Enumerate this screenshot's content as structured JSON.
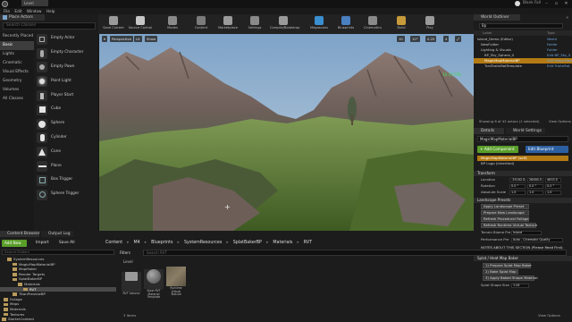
{
  "titlebar": {
    "doc_tab": "Level",
    "project": "Blank Fall",
    "min": "–",
    "max": "▫",
    "close": "✕",
    "logo": "U"
  },
  "menu": [
    "File",
    "Edit",
    "Window",
    "Help"
  ],
  "place_actors": {
    "tab": "Place Actors",
    "search_placeholder": "Search Classes",
    "categories": [
      "Recently Placed",
      "Basic",
      "Lights",
      "Cinematic",
      "Visual Effects",
      "Geometry",
      "Volumes",
      "All Classes"
    ],
    "selected_category": "Basic",
    "actors": [
      {
        "label": "Empty Actor",
        "icon": "empty-actor-icon"
      },
      {
        "label": "Empty Character",
        "icon": "character-icon"
      },
      {
        "label": "Empty Pawn",
        "icon": "pawn-icon"
      },
      {
        "label": "Point Light",
        "icon": "point-light-icon"
      },
      {
        "label": "Player Start",
        "icon": "player-start-icon"
      },
      {
        "label": "Cube",
        "icon": "cube-icon"
      },
      {
        "label": "Sphere",
        "icon": "sphere-icon"
      },
      {
        "label": "Cylinder",
        "icon": "cylinder-icon"
      },
      {
        "label": "Cone",
        "icon": "cone-icon"
      },
      {
        "label": "Plane",
        "icon": "plane-icon"
      },
      {
        "label": "Box Trigger",
        "icon": "box-trigger-icon"
      },
      {
        "label": "Sphere Trigger",
        "icon": "sphere-trigger-icon"
      }
    ]
  },
  "toolbar": {
    "buttons": [
      {
        "label": "Save Current",
        "icon": "save-icon",
        "color": "#9a9a9a"
      },
      {
        "label": "Source Control",
        "icon": "source-control-icon",
        "color": "#c6c6c6"
      },
      {
        "label": "Modes",
        "icon": "modes-icon",
        "color": "#8a8a8a"
      },
      {
        "label": "Content",
        "icon": "content-icon",
        "color": "#7b7b7b"
      },
      {
        "label": "Marketplace",
        "icon": "marketplace-icon",
        "color": "#9a9a9a"
      },
      {
        "label": "Settings",
        "icon": "settings-icon",
        "color": "#8a8a8a"
      },
      {
        "label": "Compile/Bootstrap",
        "icon": "compile-icon",
        "color": "#9a9a9a"
      },
      {
        "label": "Megascans",
        "icon": "megascans-icon",
        "color": "#3a8fd0"
      },
      {
        "label": "Blueprints",
        "icon": "blueprints-icon",
        "color": "#4a7fc0"
      },
      {
        "label": "Cinematics",
        "icon": "cinematics-icon",
        "color": "#8a8a8a"
      },
      {
        "label": "Build",
        "icon": "build-icon",
        "color": "#c79a3a"
      },
      {
        "label": "Play",
        "icon": "play-icon",
        "color": "#9a9a9a"
      }
    ]
  },
  "viewport": {
    "perspective": "Perspective",
    "lit": "Lit",
    "show": "Show",
    "fps": "16.15 FPS",
    "cursor": "+",
    "snap_values": [
      "10",
      "10°",
      "0.25",
      "4"
    ]
  },
  "world_outliner": {
    "tab": "World Outliner",
    "search_value": "Bp",
    "col_label": "Label",
    "col_type": "Type",
    "rows": [
      {
        "label": "Island_Demo (Editor)",
        "type": "World",
        "hl": false
      },
      {
        "label": "NewFolder",
        "type": "Folder",
        "hl": false
      },
      {
        "label": "Lighting & Visuals",
        "type": "Folder",
        "hl": false
      },
      {
        "label": "BP_Sky_Sphere_0",
        "type": "Edit BP_Sky_S",
        "hl": false
      },
      {
        "label": "MagicMapMaterialBP",
        "type": "Edit MagicMap",
        "hl": true
      },
      {
        "label": "TrailTrailsMatTemplate",
        "type": "Edit TrailsMat",
        "hl": false
      }
    ],
    "status": "Showing 6 of 42 actors (1 selected)",
    "view_options": "View Options"
  },
  "details": {
    "tab": "Details",
    "tab2": "World Settings",
    "search_value": "MagicMapMaterialBP",
    "add_component": "+ Add Component",
    "edit_blueprint": "Edit Blueprint",
    "component_selected": "MagicMapMaterialBP (self)",
    "component_sub": "BP Logo (Inherited)",
    "transform_header": "Transform",
    "location_label": "Location",
    "rotation_label": "Rotation",
    "scale_label": "Absolute Scale",
    "location": [
      "-33162.0",
      "28480.0",
      "4633.0"
    ],
    "rotation": [
      "0.0 °",
      "0.0 °",
      "0.0 °"
    ],
    "scale": [
      "1.0",
      "1.0",
      "1.0"
    ],
    "landscape_presets": "Landscape Presets",
    "preset_buttons": [
      "Apply Landscape Preset",
      "Prepare New Landscape",
      "Refresh Procedural Foliage",
      "Refresh Runtime Virtual Texture"
    ],
    "terrain_biome_label": "Terrain Biome Pre",
    "terrain_biome_value": "Island",
    "performance_label": "Performance Pre",
    "performance_value": "Auto - Cinematic Quality",
    "notes": "NOTES ABOUT THIS SECTION (Please Read First)",
    "splat_header": "Splat / Heat Map Baker",
    "splat_buttons": [
      "1) Prepare Splat Map Baker",
      "2) Bake Splat Map",
      "3) Apply Baked Shape Material"
    ],
    "splat_size_label": "Splat Shape Size",
    "splat_size_value": "1.04"
  },
  "content_browser": {
    "tab": "Content Browser",
    "tab2": "Output Log",
    "add_new": "Add New",
    "import": "Import",
    "save_all": "Save All",
    "path": [
      "Content",
      "M4",
      "Blueprints",
      "SystemResources",
      "SplatBakerBP",
      "Materials",
      "RVT"
    ],
    "tree_search": "Search Folders",
    "tree": [
      {
        "label": "SystemResources",
        "indent": 8,
        "sel": false
      },
      {
        "label": "MagicMapMaterialBP",
        "indent": 14,
        "sel": false
      },
      {
        "label": "MapMaker",
        "indent": 14,
        "sel": false
      },
      {
        "label": "Render Targets",
        "indent": 14,
        "sel": false
      },
      {
        "label": "SplatBakerBP",
        "indent": 14,
        "sel": false
      },
      {
        "label": "Materials",
        "indent": 20,
        "sel": false
      },
      {
        "label": "RVT",
        "indent": 26,
        "sel": true
      },
      {
        "label": "TitanPreviewBP",
        "indent": 14,
        "sel": false
      },
      {
        "label": "Foliage",
        "indent": 4,
        "sel": false
      },
      {
        "label": "Maps",
        "indent": 4,
        "sel": false
      },
      {
        "label": "Materials",
        "indent": 4,
        "sel": false
      },
      {
        "label": "Textures",
        "indent": 4,
        "sel": false
      },
      {
        "label": "StarterContent",
        "indent": 2,
        "sel": false
      }
    ],
    "filters": "Filters",
    "asset_search": "Search RVT",
    "level_label": "Level",
    "assets": [
      {
        "label": "RVT Volume",
        "kind": "folder"
      },
      {
        "label": "Splat RVT Material Template",
        "kind": "sphere"
      },
      {
        "label": "Runtime Virtual Texture",
        "kind": "rock"
      }
    ],
    "item_count": "3 items",
    "view_options": "View Options"
  }
}
